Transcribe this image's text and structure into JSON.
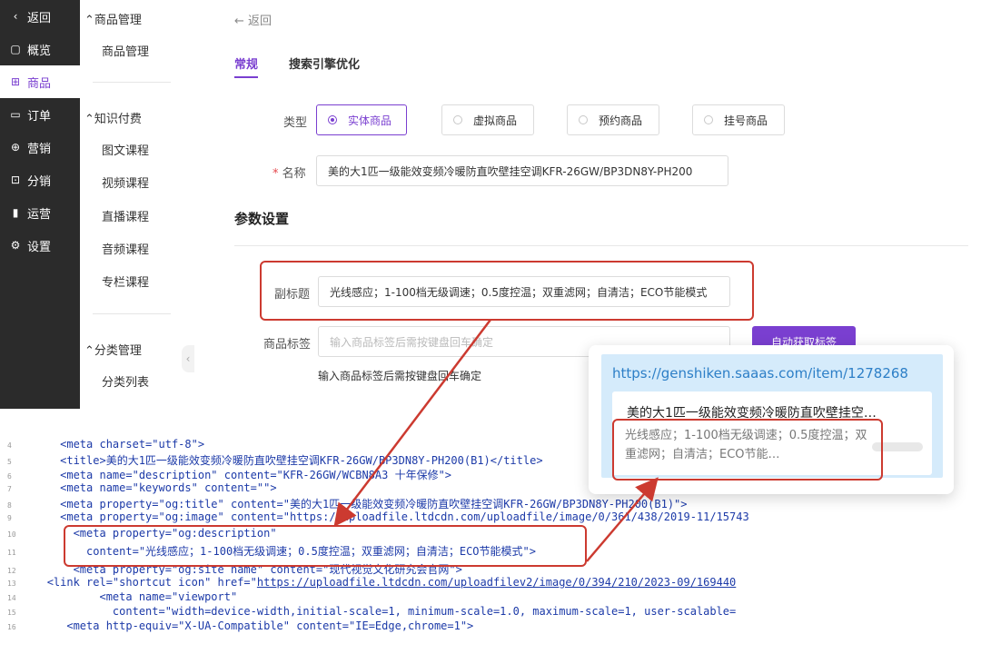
{
  "nav": {
    "back": "返回",
    "items": [
      {
        "icon": "▢",
        "label": "概览"
      },
      {
        "icon": "⊞",
        "label": "商品"
      },
      {
        "icon": "▭",
        "label": "订单"
      },
      {
        "icon": "⊕",
        "label": "营销"
      },
      {
        "icon": "⊡",
        "label": "分销"
      },
      {
        "icon": "▮",
        "label": "运营"
      },
      {
        "icon": "⚙",
        "label": "设置"
      }
    ]
  },
  "subnav": {
    "group1": "商品管理",
    "group1_items": [
      "商品管理"
    ],
    "group2": "知识付费",
    "group2_items": [
      "图文课程",
      "视频课程",
      "直播课程",
      "音频课程",
      "专栏课程"
    ],
    "group3": "分类管理",
    "group3_items": [
      "分类列表"
    ]
  },
  "main": {
    "back": "← 返回",
    "tabs": [
      "常规",
      "搜索引擎优化"
    ],
    "type_label": "类型",
    "types": [
      "实体商品",
      "虚拟商品",
      "预约商品",
      "挂号商品"
    ],
    "name_label": "名称",
    "name_value": "美的大1匹一级能效变频冷暖防直吹壁挂空调KFR-26GW/BP3DN8Y-PH200",
    "section_title": "参数设置",
    "subtitle_label": "副标题",
    "subtitle_value": "光线感应；1-100档无级调速；0.5度控温；双重滤网；自清洁；ECO节能模式",
    "tags_label": "商品标签",
    "tags_placeholder": "输入商品标签后需按键盘回车确定",
    "auto_button": "自动获取标签",
    "tags_hint": "输入商品标签后需按键盘回车确定"
  },
  "preview": {
    "url": "https://genshiken.saaas.com/item/1278268",
    "title": "美的大1匹一级能效变频冷暖防直吹壁挂空…",
    "desc": "光线感应；1-100档无级调速；0.5度控温；双重滤网；自清洁；ECO节能…"
  },
  "code": {
    "line_numbers": [
      "4",
      "5",
      "6",
      "7",
      "8",
      "9",
      "10",
      "11",
      "12",
      "13",
      "14",
      "15",
      "16"
    ],
    "l4": "<meta charset=\"utf-8\">",
    "l5": "<title>美的大1匹一级能效变频冷暖防直吹壁挂空调KFR-26GW/BP3DN8Y-PH200(B1)</title>",
    "l6": "<meta name=\"description\" content=\"KFR-26GW/WCBN8A3 十年保修\">",
    "l7": "<meta name=\"keywords\" content=\"\">",
    "l8": "<meta property=\"og:title\" content=\"美的大1匹一级能效变频冷暖防直吹壁挂空调KFR-26GW/BP3DN8Y-PH200(B1)\">",
    "l9": "<meta property=\"og:image\" content=\"https://uploadfile.ltdcdn.com/uploadfile/image/0/361/438/2019-11/15743",
    "l10": "<meta property=\"og:description\"",
    "l11": "content=\"光线感应；1-100档无级调速；0.5度控温；双重滤网；自清洁；ECO节能模式\">",
    "l12": "<meta property=\"og:site_name\" content=\"现代视觉文化研究会官网\">",
    "l13_pre": "<link rel=\"shortcut icon\" href=\"",
    "l13_link": "https://uploadfile.ltdcdn.com/uploadfilev2/image/0/394/210/2023-09/169440",
    "l14": "<meta name=\"viewport\"",
    "l15": "content=\"width=device-width,initial-scale=1, minimum-scale=1.0, maximum-scale=1, user-scalable=",
    "l16": "<meta http-equiv=\"X-UA-Compatible\" content=\"IE=Edge,chrome=1\">"
  },
  "colors": {
    "accent": "#7a3fd0",
    "highlight": "#cc3a30",
    "nav_bg": "#2b2b2b",
    "preview_bg": "#d5ebfb",
    "link": "#2d7fc7"
  }
}
